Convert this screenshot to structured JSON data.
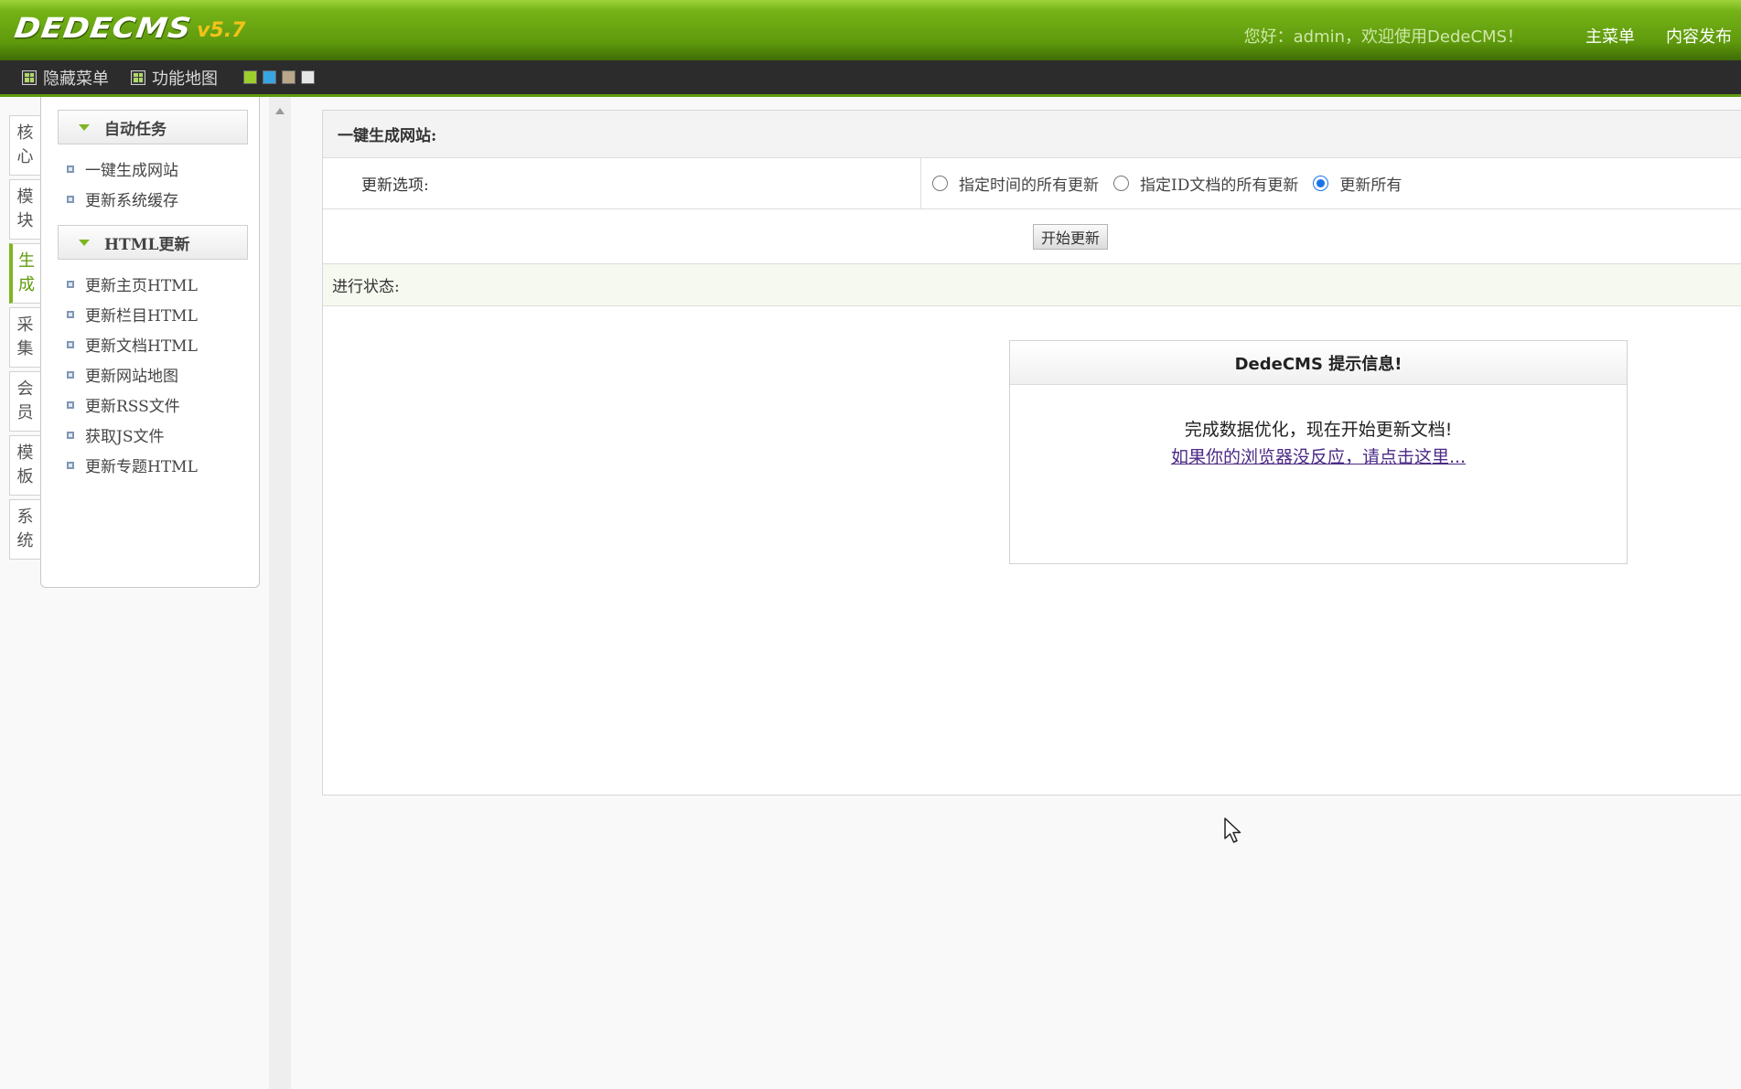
{
  "header": {
    "logo_text": "DEDECMS",
    "logo_version": "v5.7",
    "welcome": "您好：admin，欢迎使用DedeCMS！",
    "links": [
      "主菜单",
      "内容发布"
    ]
  },
  "toolbar": {
    "hide_menu": "隐藏菜单",
    "function_map": "功能地图",
    "swatches": [
      "#9ccf2d",
      "#37a6e0",
      "#b9a78a",
      "#e6e6e6"
    ]
  },
  "vtabs": [
    {
      "line1": "核",
      "line2": "心"
    },
    {
      "line1": "模",
      "line2": "块"
    },
    {
      "line1": "生",
      "line2": "成"
    },
    {
      "line1": "采",
      "line2": "集"
    },
    {
      "line1": "会",
      "line2": "员"
    },
    {
      "line1": "模",
      "line2": "板"
    },
    {
      "line1": "系",
      "line2": "统"
    }
  ],
  "sidebar": {
    "groups": [
      {
        "title": "自动任务",
        "items": [
          "一键生成网站",
          "更新系统缓存"
        ]
      },
      {
        "title": "HTML更新",
        "items": [
          "更新主页HTML",
          "更新栏目HTML",
          "更新文档HTML",
          "更新网站地图",
          "更新RSS文件",
          "获取JS文件",
          "更新专题HTML"
        ]
      }
    ]
  },
  "main": {
    "title": "一键生成网站:",
    "options_label": "更新选项:",
    "radios": [
      {
        "label": "指定时间的所有更新",
        "checked": false
      },
      {
        "label": "指定ID文档的所有更新",
        "checked": false
      },
      {
        "label": "更新所有",
        "checked": true
      }
    ],
    "start_button": "开始更新",
    "status_label": "进行状态:"
  },
  "message": {
    "title": "DedeCMS 提示信息!",
    "text": "完成数据优化，现在开始更新文档!",
    "link": "如果你的浏览器没反应，请点击这里..."
  },
  "colors": {
    "header_green": "#5f9a0d",
    "accent_green": "#7fb523",
    "toolbar_dark": "#2c2c2c",
    "radio_blue": "#1a73e8",
    "link_purple": "#4b2a86"
  }
}
